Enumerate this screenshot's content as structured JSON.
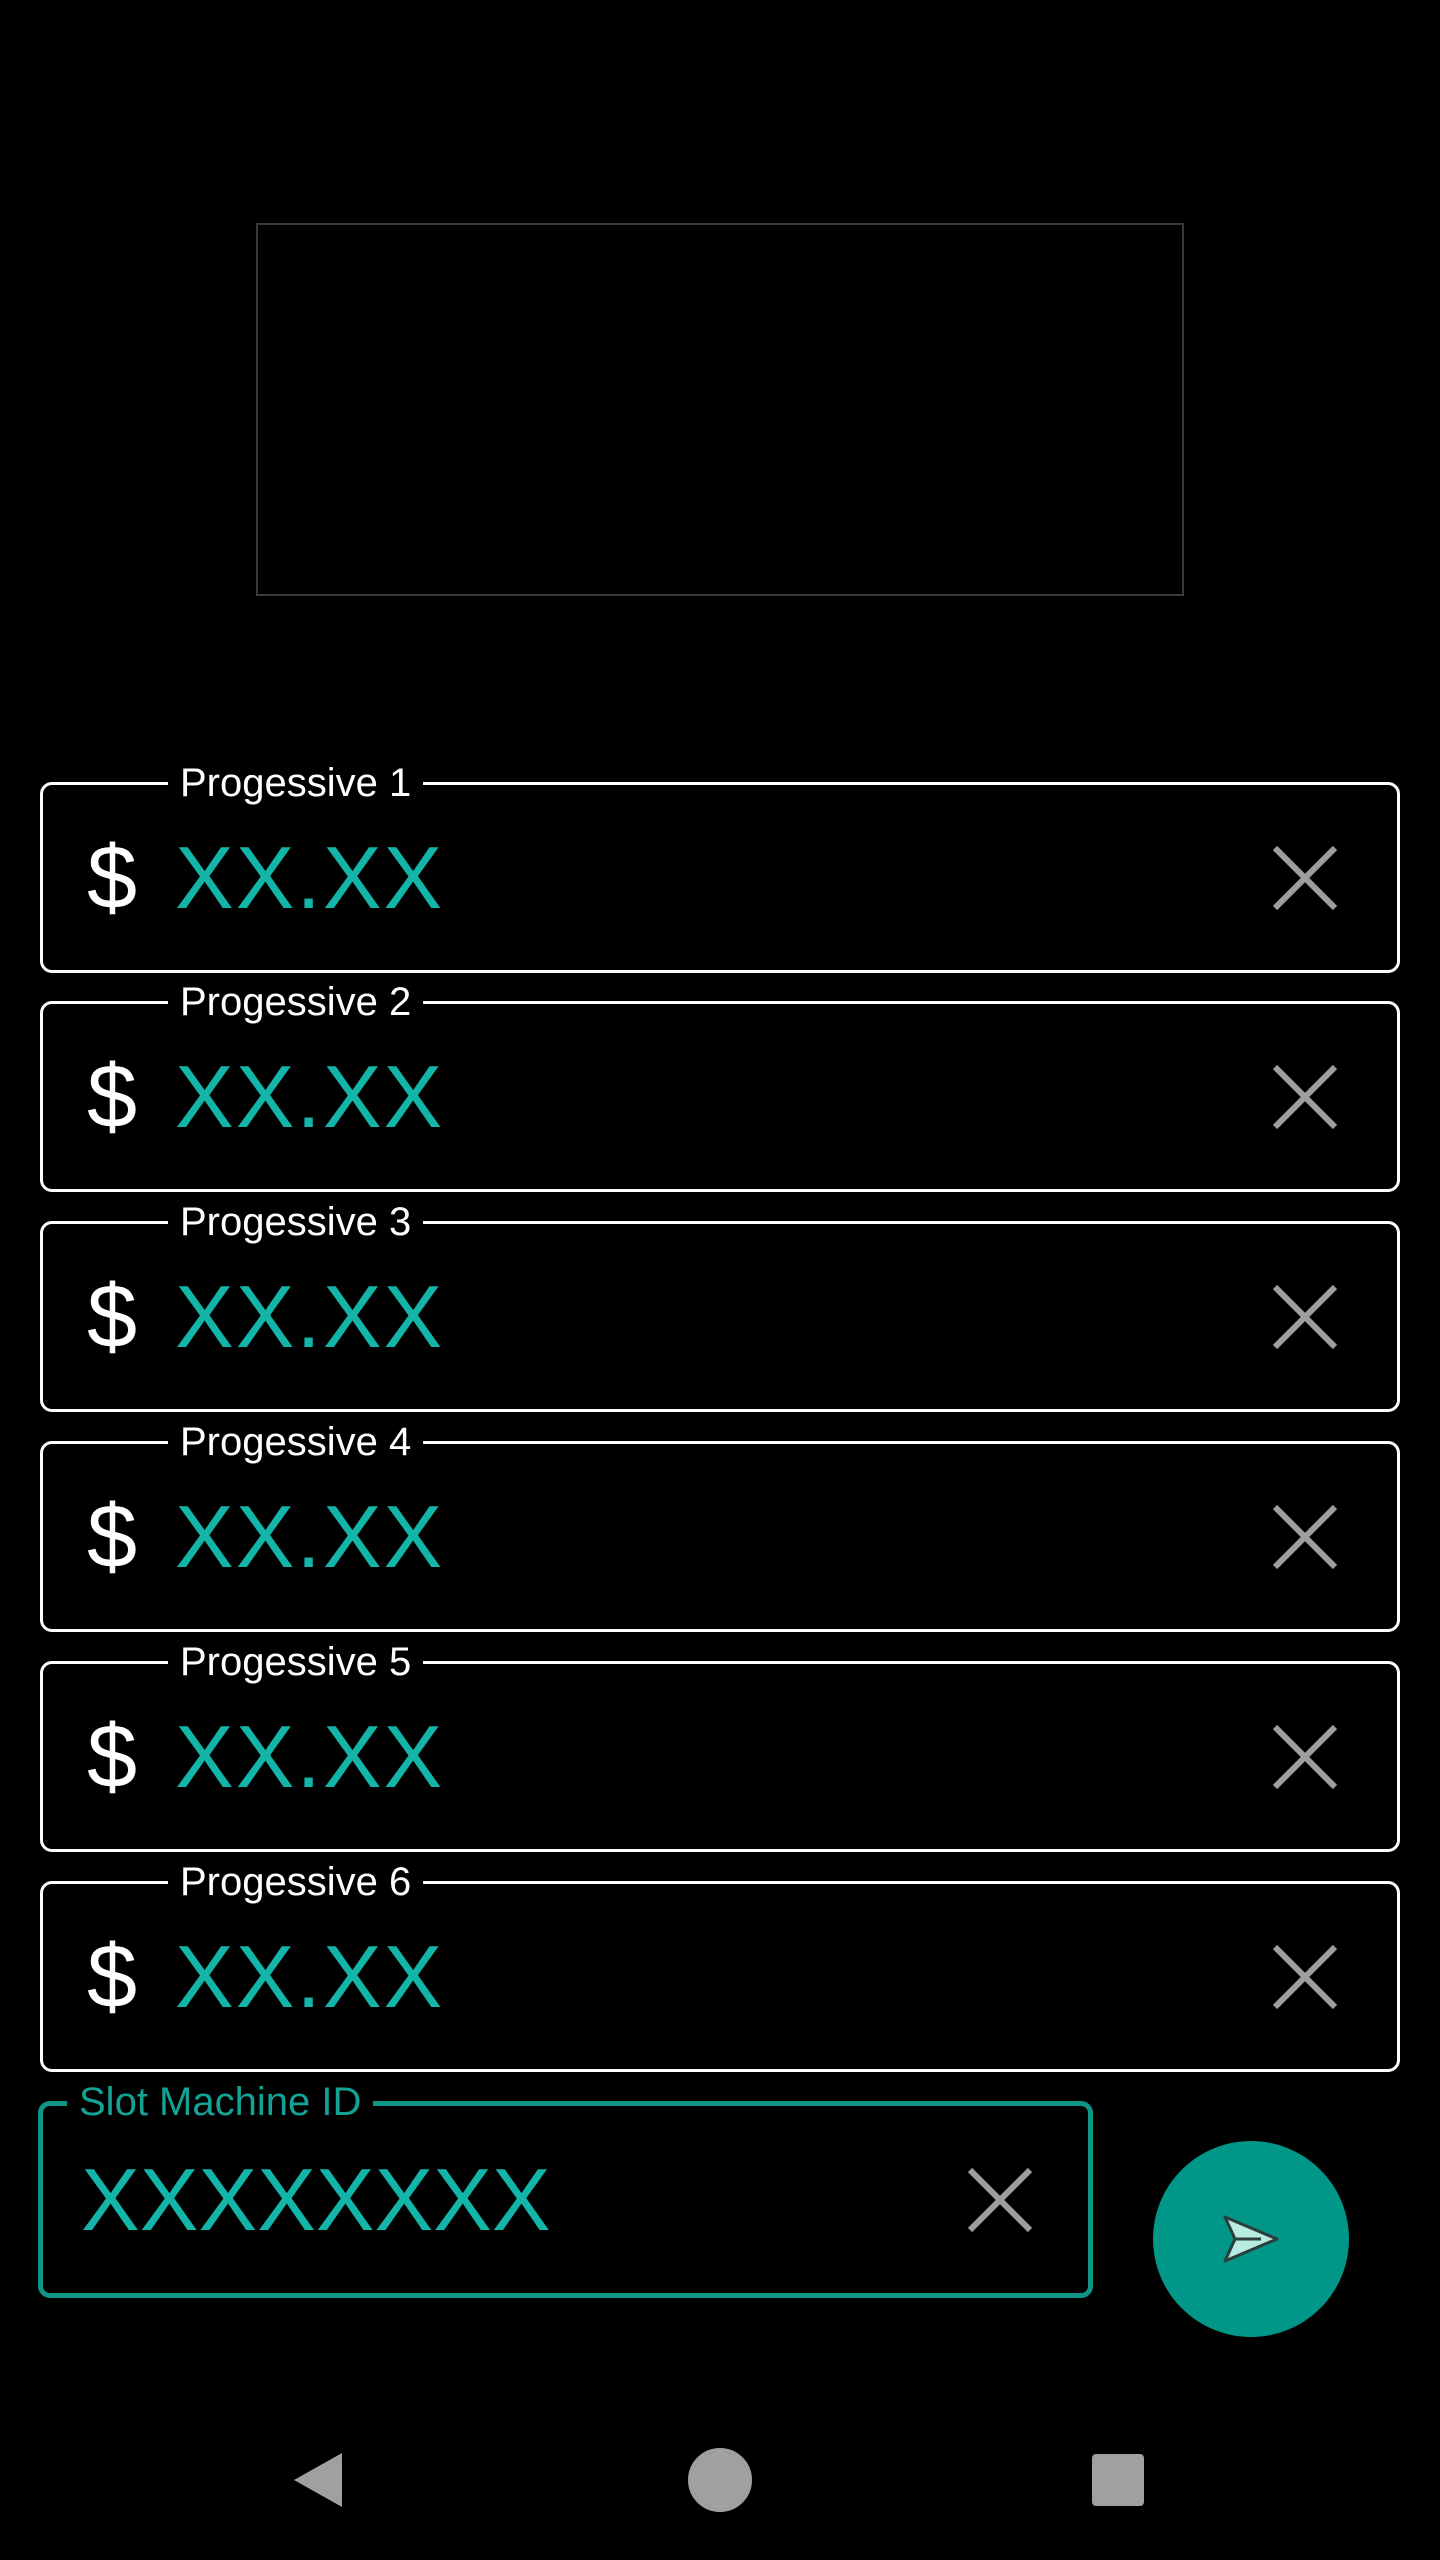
{
  "progressives": [
    {
      "label": "Progessive 1",
      "currency": "$",
      "placeholder": "XX.XX"
    },
    {
      "label": "Progessive 2",
      "currency": "$",
      "placeholder": "XX.XX"
    },
    {
      "label": "Progessive 3",
      "currency": "$",
      "placeholder": "XX.XX"
    },
    {
      "label": "Progessive 4",
      "currency": "$",
      "placeholder": "XX.XX"
    },
    {
      "label": "Progessive 5",
      "currency": "$",
      "placeholder": "XX.XX"
    },
    {
      "label": "Progessive 6",
      "currency": "$",
      "placeholder": "XX.XX"
    }
  ],
  "slot_machine": {
    "label": "Slot Machine ID",
    "placeholder": "XXXXXXXX"
  },
  "icons": {
    "clear": "close-icon",
    "send": "send-icon",
    "nav_back": "back-triangle-icon",
    "nav_home": "home-circle-icon",
    "nav_recents": "recents-square-icon"
  },
  "colors": {
    "background": "#000000",
    "accent": "#009688",
    "placeholder_text": "#12b5a8",
    "field_border": "#ffffff",
    "clear_icon": "#9e9e9e",
    "nav_icon": "#a0a0a0"
  }
}
